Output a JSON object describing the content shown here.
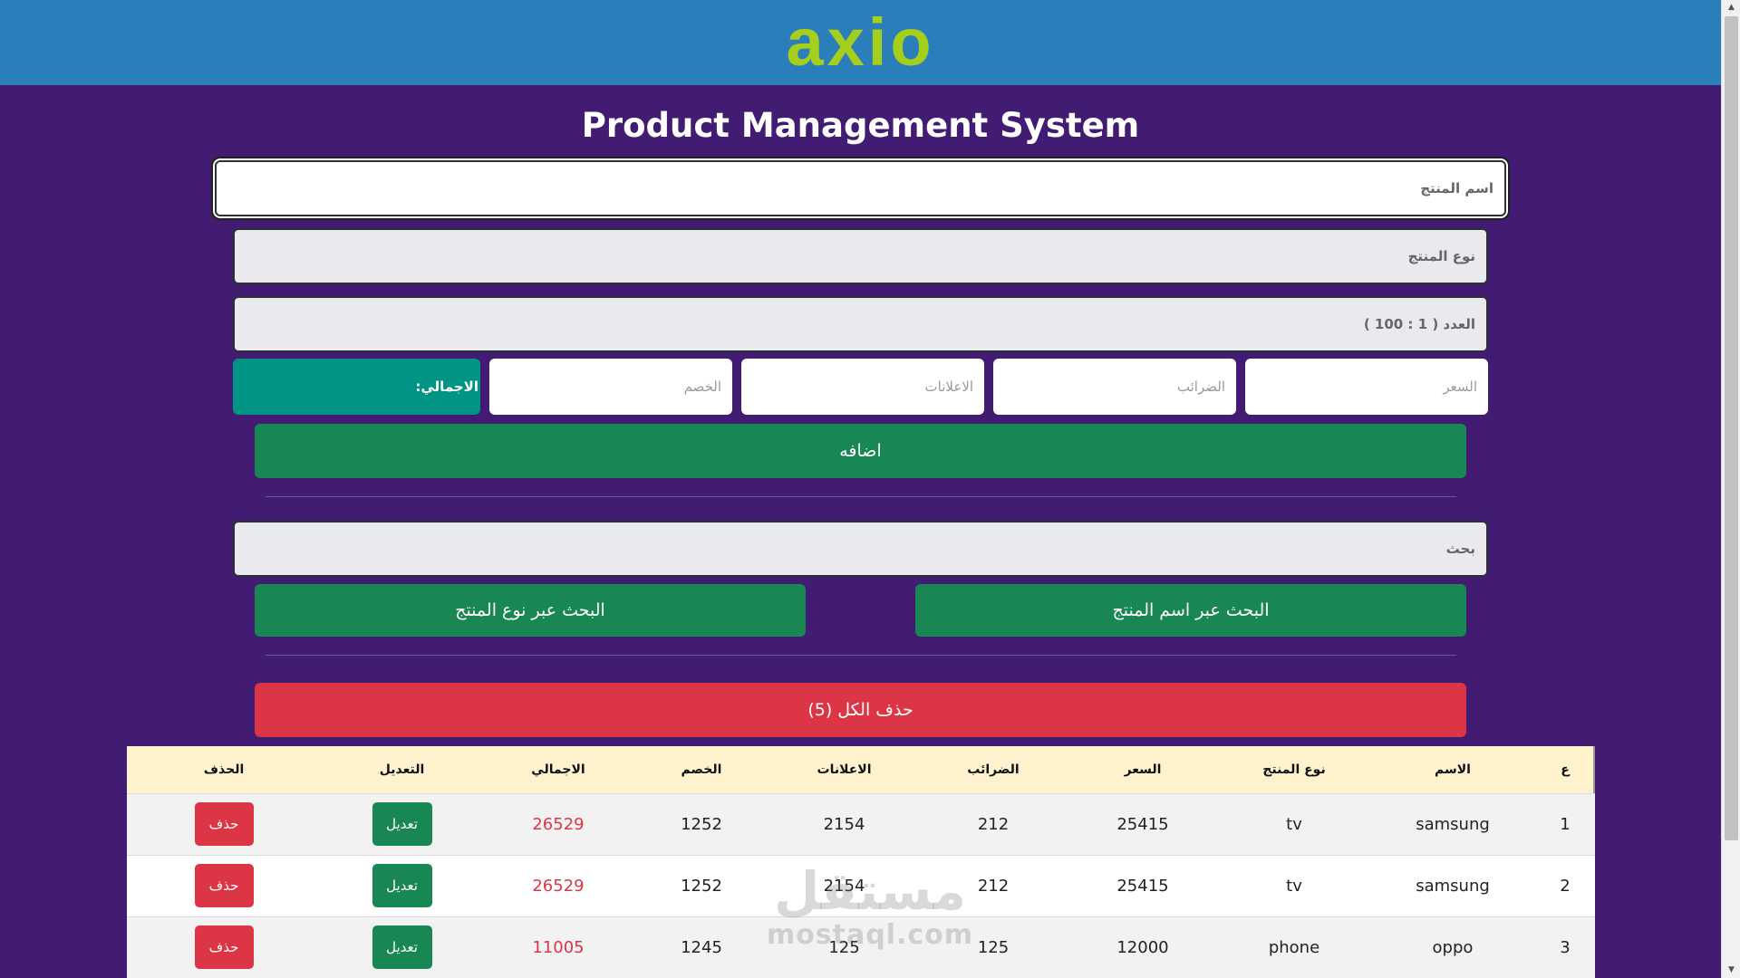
{
  "header": {
    "logo_text": "axio",
    "logo_color": "#a6cf1d",
    "bar_color": "#2a7fba"
  },
  "page": {
    "title": "Product Management System",
    "background_color": "#421c72"
  },
  "form": {
    "name_placeholder": "اسم المنتج",
    "category_placeholder": "نوع المنتج",
    "count_placeholder": "العدد ( 1 : 100 )",
    "price_placeholder": "السعر",
    "taxes_placeholder": "الضرائب",
    "ads_placeholder": "الاعلانات",
    "discount_placeholder": "الخصم",
    "total_label": "الاجمالي:",
    "add_button": "اضافه"
  },
  "search": {
    "placeholder": "بحث",
    "by_name_button": "البحث عبر اسم المنتج",
    "by_category_button": "البحث عبر نوع المنتج"
  },
  "delete_all_button": "حذف الكل (5)",
  "table": {
    "headers": [
      "ع",
      "الاسم",
      "نوع المنتج",
      "السعر",
      "الضرائب",
      "الاعلانات",
      "الخصم",
      "الاجمالي",
      "التعديل",
      "الحذف"
    ],
    "rows": [
      {
        "id": "1",
        "name": "samsung",
        "category": "tv",
        "price": "25415",
        "taxes": "212",
        "ads": "2154",
        "discount": "1252",
        "total": "26529",
        "edit": "تعديل",
        "delete": "حذف"
      },
      {
        "id": "2",
        "name": "samsung",
        "category": "tv",
        "price": "25415",
        "taxes": "212",
        "ads": "2154",
        "discount": "1252",
        "total": "26529",
        "edit": "تعديل",
        "delete": "حذف"
      },
      {
        "id": "3",
        "name": "oppo",
        "category": "phone",
        "price": "12000",
        "taxes": "125",
        "ads": "125",
        "discount": "1245",
        "total": "11005",
        "edit": "تعديل",
        "delete": "حذف"
      }
    ]
  },
  "watermark": {
    "arabic": "مستقل",
    "latin": "mostaql.com"
  },
  "colors": {
    "green_button": "#198754",
    "red_button": "#dc3545",
    "total_box": "#009484",
    "table_header": "#fff3cd"
  }
}
